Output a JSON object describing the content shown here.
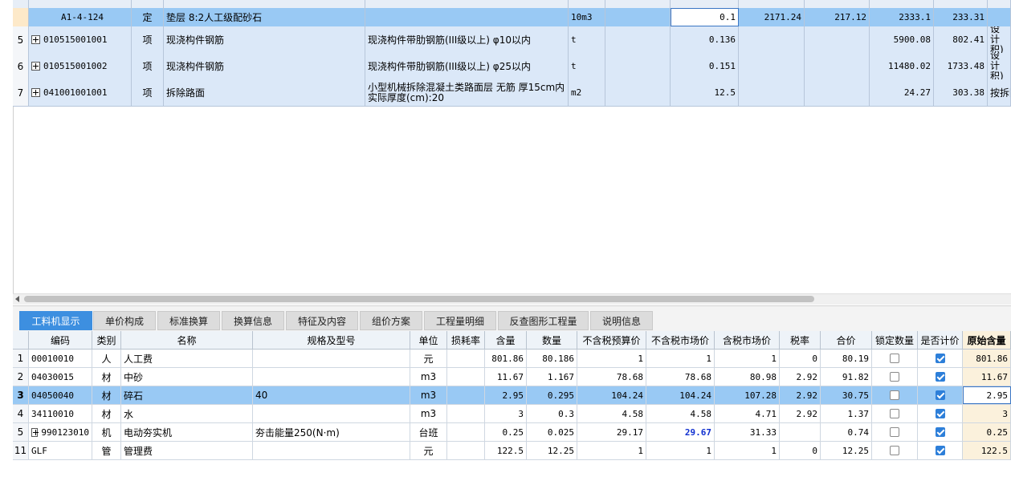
{
  "upper_grid": {
    "rows": [
      {
        "index": "",
        "code": "A1-4-124",
        "type": "定",
        "name": "垫层 8:2人工级配砂石",
        "spec": "",
        "unit": "10m3",
        "qty_expr": "",
        "qty": "0.1",
        "price": "2171.24",
        "total_a": "217.12",
        "unit_price": "2333.1",
        "amount": "233.31",
        "rule": ""
      },
      {
        "index": "5",
        "code": "010515001001",
        "type": "项",
        "name": "现浇构件钢筋",
        "spec": "现浇构件带肋钢筋(III级以上) φ10以内",
        "unit": "t",
        "qty_expr": "",
        "qty": "0.136",
        "price": "",
        "total_a": "",
        "unit_price": "5900.08",
        "amount": "802.41",
        "rule": "按设计\n积)乘"
      },
      {
        "index": "6",
        "code": "010515001002",
        "type": "项",
        "name": "现浇构件钢筋",
        "spec": "现浇构件带肋钢筋(III级以上) φ25以内",
        "unit": "t",
        "qty_expr": "",
        "qty": "0.151",
        "price": "",
        "total_a": "",
        "unit_price": "11480.02",
        "amount": "1733.48",
        "rule": "按设计\n积)乘"
      },
      {
        "index": "7",
        "code": "041001001001",
        "type": "项",
        "name": "拆除路面",
        "spec": "小型机械拆除混凝土类路面层 无筋 厚15cm内\n实际厚度(cm):20",
        "unit": "m2",
        "qty_expr": "",
        "qty": "12.5",
        "price": "",
        "total_a": "",
        "unit_price": "24.27",
        "amount": "303.38",
        "rule": "按拆除"
      }
    ]
  },
  "tabs": [
    "工料机显示",
    "单价构成",
    "标准换算",
    "换算信息",
    "特征及内容",
    "组价方案",
    "工程量明细",
    "反查图形工程量",
    "说明信息"
  ],
  "lower_grid": {
    "headers": [
      "编码",
      "类别",
      "名称",
      "规格及型号",
      "单位",
      "损耗率",
      "含量",
      "数量",
      "不含税预算价",
      "不含税市场价",
      "含税市场价",
      "税率",
      "合价",
      "锁定数量",
      "是否计价",
      "原始含量"
    ],
    "rows": [
      {
        "idx": "1",
        "code": "00010010",
        "cat": "人",
        "name": "人工费",
        "spec": "",
        "unit": "元",
        "loss": "",
        "content": "801.86",
        "qty": "80.186",
        "budget": "1",
        "market": "1",
        "tax_market": "1",
        "rate": "0",
        "total": "80.19",
        "lock": false,
        "priced": true,
        "orig": "801.86"
      },
      {
        "idx": "2",
        "code": "04030015",
        "cat": "材",
        "name": "中砂",
        "spec": "",
        "unit": "m3",
        "loss": "",
        "content": "11.67",
        "qty": "1.167",
        "budget": "78.68",
        "market": "78.68",
        "tax_market": "80.98",
        "rate": "2.92",
        "total": "91.82",
        "lock": false,
        "priced": true,
        "orig": "11.67"
      },
      {
        "idx": "3",
        "code": "04050040",
        "cat": "材",
        "name": "碎石",
        "spec": "40",
        "unit": "m3",
        "loss": "",
        "content": "2.95",
        "qty": "0.295",
        "budget": "104.24",
        "market": "104.24",
        "tax_market": "107.28",
        "rate": "2.92",
        "total": "30.75",
        "lock": false,
        "priced": true,
        "orig": "2.95"
      },
      {
        "idx": "4",
        "code": "34110010",
        "cat": "材",
        "name": "水",
        "spec": "",
        "unit": "m3",
        "loss": "",
        "content": "3",
        "qty": "0.3",
        "budget": "4.58",
        "market": "4.58",
        "tax_market": "4.71",
        "rate": "2.92",
        "total": "1.37",
        "lock": false,
        "priced": true,
        "orig": "3"
      },
      {
        "idx": "5",
        "code": "990123010",
        "cat": "机",
        "name": "电动夯实机",
        "spec": "夯击能量250(N·m)",
        "unit": "台班",
        "loss": "",
        "content": "0.25",
        "qty": "0.025",
        "budget": "29.17",
        "market": "29.67",
        "tax_market": "31.33",
        "rate": "",
        "total": "0.74",
        "lock": false,
        "priced": true,
        "orig": "0.25"
      },
      {
        "idx": "11",
        "code": "GLF",
        "cat": "管",
        "name": "管理费",
        "spec": "",
        "unit": "元",
        "loss": "",
        "content": "122.5",
        "qty": "12.25",
        "budget": "1",
        "market": "1",
        "tax_market": "1",
        "rate": "0",
        "total": "12.25",
        "lock": false,
        "priced": true,
        "orig": "122.5"
      }
    ]
  },
  "colors": {
    "selected_row": "#99c9f4",
    "active_tab": "#3d8fe0",
    "row_bg": "#dbe8f8",
    "highlight_col": "#fbf1dc",
    "market_changed": "#1030d0"
  }
}
